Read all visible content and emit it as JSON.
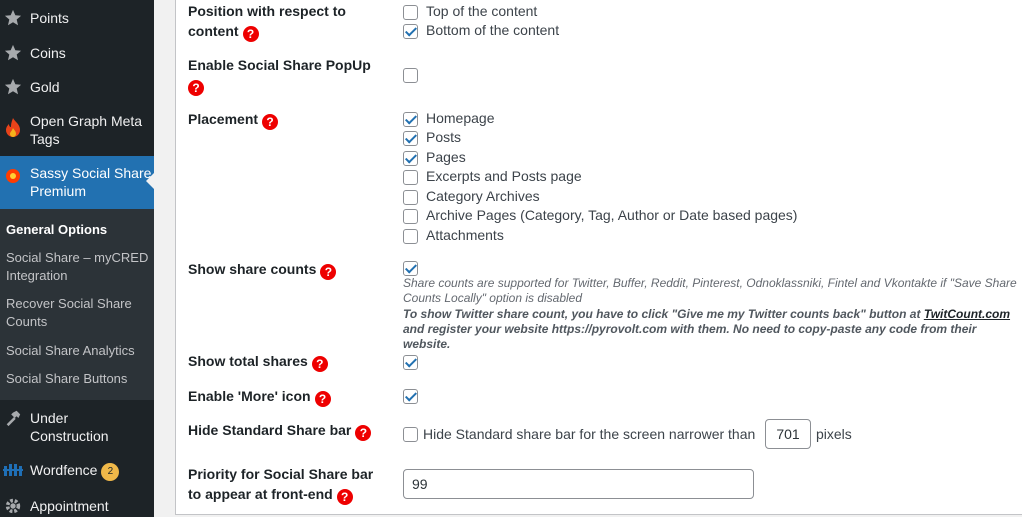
{
  "sidebar": {
    "menu": [
      {
        "label": "Points",
        "icon": "star-icon"
      },
      {
        "label": "Coins",
        "icon": "star-icon"
      },
      {
        "label": "Gold",
        "icon": "star-icon"
      },
      {
        "label": "Open Graph Meta Tags",
        "icon": "flame-icon"
      },
      {
        "label": "Sassy Social Share Premium",
        "icon": "sassy-logo-icon"
      },
      {
        "label": "Under Construction",
        "icon": "hammer-icon"
      },
      {
        "label": "Wordfence",
        "icon": "wordfence-icon",
        "badge": "2"
      },
      {
        "label": "Appointment",
        "icon": "gear-icon"
      }
    ],
    "submenu": [
      "General Options",
      "Social Share – myCRED Integration",
      "Recover Social Share Counts",
      "Social Share Analytics",
      "Social Share Buttons"
    ]
  },
  "settings": {
    "position": {
      "label": "Position with respect to content",
      "options": [
        {
          "label": "Top of the content",
          "checked": false
        },
        {
          "label": "Bottom of the content",
          "checked": true
        }
      ]
    },
    "popup": {
      "label": "Enable Social Share PopUp",
      "checked": false
    },
    "placement": {
      "label": "Placement",
      "options": [
        {
          "label": "Homepage",
          "checked": true
        },
        {
          "label": "Posts",
          "checked": true
        },
        {
          "label": "Pages",
          "checked": true
        },
        {
          "label": "Excerpts and Posts page",
          "checked": false
        },
        {
          "label": "Category Archives",
          "checked": false
        },
        {
          "label": "Archive Pages (Category, Tag, Author or Date based pages)",
          "checked": false
        },
        {
          "label": "Attachments",
          "checked": false
        }
      ]
    },
    "share_counts": {
      "label": "Show share counts",
      "checked": true,
      "note": "Share counts are supported for Twitter, Buffer, Reddit, Pinterest, Odnoklassniki, Fintel and Vkontakte if \"Save Share Counts Locally\" option is disabled",
      "note2_before": "To show Twitter share count, you have to click \"Give me my Twitter counts back\" button at ",
      "note2_link": "TwitCount.com",
      "note2_after": " and register your website https://pyrovolt.com with them. No need to copy-paste any code from their website."
    },
    "total_shares": {
      "label": "Show total shares",
      "checked": true
    },
    "more_icon": {
      "label": "Enable 'More' icon",
      "checked": true
    },
    "hide_bar": {
      "label": "Hide Standard Share bar",
      "checked": false,
      "text_before": "Hide Standard share bar for the screen narrower than",
      "value": "701",
      "text_after": "pixels"
    },
    "priority": {
      "label": "Priority for Social Share bar to appear at front-end",
      "value": "99"
    }
  },
  "help_glyph": "?",
  "colors": {
    "sidebar_bg": "#1d2327",
    "active_bg": "#2271b1",
    "help_red": "#e00000",
    "badge": "#f0b849"
  }
}
